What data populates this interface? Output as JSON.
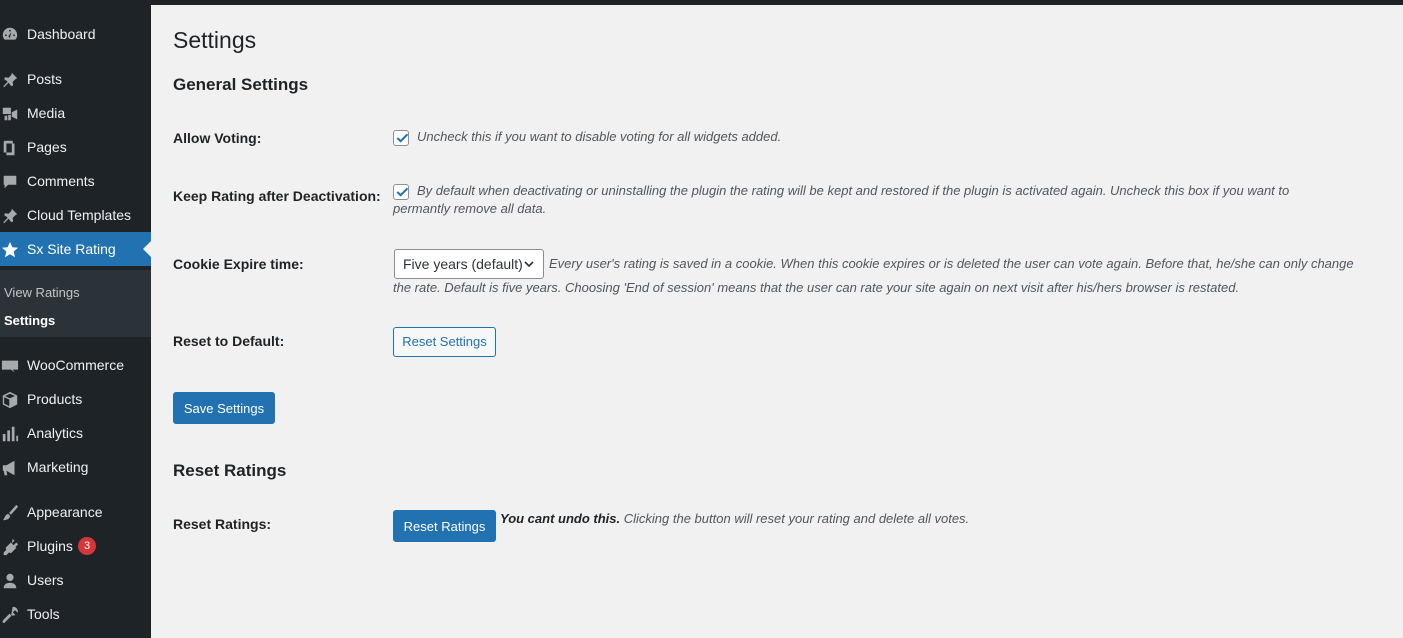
{
  "sidebar": {
    "items": [
      {
        "label": "Dashboard",
        "icon": "dashboard-icon"
      },
      {
        "label": "Posts",
        "icon": "pin-icon"
      },
      {
        "label": "Media",
        "icon": "media-icon"
      },
      {
        "label": "Pages",
        "icon": "pages-icon"
      },
      {
        "label": "Comments",
        "icon": "comment-icon"
      },
      {
        "label": "Cloud Templates",
        "icon": "pin-icon"
      },
      {
        "label": "Sx Site Rating",
        "icon": "star-icon",
        "active": true
      },
      {
        "label": "WooCommerce",
        "icon": "woo-icon"
      },
      {
        "label": "Products",
        "icon": "box-icon"
      },
      {
        "label": "Analytics",
        "icon": "bar-chart-icon"
      },
      {
        "label": "Marketing",
        "icon": "megaphone-icon"
      },
      {
        "label": "Appearance",
        "icon": "brush-icon"
      },
      {
        "label": "Plugins",
        "icon": "plug-icon",
        "badge": "3"
      },
      {
        "label": "Users",
        "icon": "user-icon"
      },
      {
        "label": "Tools",
        "icon": "wrench-icon"
      }
    ],
    "submenu": [
      {
        "label": "View Ratings"
      },
      {
        "label": "Settings",
        "current": true
      }
    ]
  },
  "page": {
    "title": "Settings",
    "general_heading": "General Settings",
    "allow_voting": {
      "label": "Allow Voting:",
      "checked": true,
      "description": "Uncheck this if you want to disable voting for all widgets added."
    },
    "keep_rating": {
      "label": "Keep Rating after Deactivation:",
      "checked": true,
      "description_line1": "By default when deactivating or uninstalling the plugin the rating will be kept and restored if the plugin is activated again. Uncheck this box if you want to",
      "description_line2": "permantly remove all data."
    },
    "cookie_expire": {
      "label": "Cookie Expire time:",
      "selected": "Five years (default)",
      "description_line1": "Every user's rating is saved in a cookie. When this cookie expires or is deleted the user can vote again. Before that, he/she can only change",
      "description_line2": "the rate. Default is five years. Choosing 'End of session' means that the user can rate your site again on next visit after his/hers browser is restated."
    },
    "reset_default": {
      "label": "Reset to Default:",
      "button": "Reset Settings"
    },
    "save_button": "Save Settings",
    "reset_heading": "Reset Ratings",
    "reset_ratings": {
      "label": "Reset Ratings:",
      "button": "Reset Ratings",
      "warning_bold": "You cant undo this.",
      "warning_text": "Clicking the button will reset your rating and delete all votes."
    }
  },
  "colors": {
    "sidebar_bg": "#1d2327",
    "accent": "#2271b1",
    "page_bg": "#f1f1f1",
    "badge": "#d63638"
  }
}
